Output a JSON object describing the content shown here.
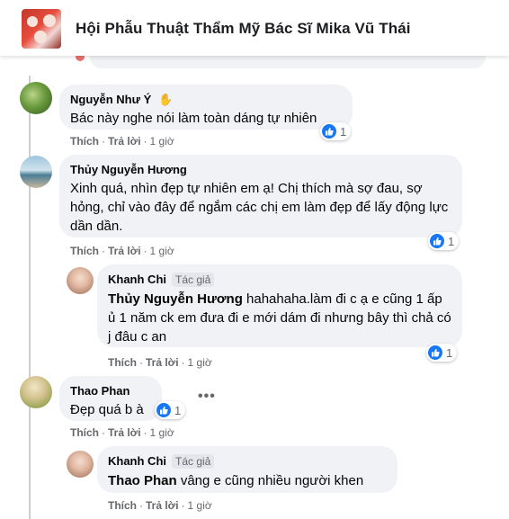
{
  "group": {
    "title": "Hội Phẫu Thuật Thẩm Mỹ Bác Sĩ Mika Vũ Thái"
  },
  "comments": [
    {
      "author": "Nguyễn Như Ý",
      "author_icon": "wave-hand-icon",
      "text": "Bác này nghe nói làm toàn dáng tự nhiên",
      "actions": {
        "like": "Thích",
        "reply": "Trả lời",
        "time": "1 giờ"
      },
      "reactions": "1"
    },
    {
      "author": "Thủy Nguyễn Hương",
      "text": "Xinh quá, nhìn đẹp tự nhiên em ạ! Chị thích mà sợ đau, sợ hỏng, chỉ vào đây để ngắm các chị em làm đẹp để lấy động lực dần dần.",
      "actions": {
        "like": "Thích",
        "reply": "Trả lời",
        "time": "1 giờ"
      },
      "reactions": "1"
    },
    {
      "author": "Khanh Chi",
      "badge": "Tác giả",
      "mention": "Thủy Nguyễn Hương",
      "text": " hahahaha.làm đi c ạ e cũng 1 ấp ủ 1 năm ck em đưa đi e mới dám đi nhưng bây thì chả có j đâu c an",
      "actions": {
        "like": "Thích",
        "reply": "Trả lời",
        "time": "1 giờ"
      },
      "reactions": "1"
    },
    {
      "author": "Thao Phan",
      "text": "Đẹp quá b à",
      "actions": {
        "like": "Thích",
        "reply": "Trả lời",
        "time": "1 giờ"
      },
      "reactions": "1",
      "more": "•••"
    },
    {
      "author": "Khanh Chi",
      "badge": "Tác giả",
      "mention": "Thao Phan",
      "text": " vâng e cũng nhiều người khen",
      "actions": {
        "like": "Thích",
        "reply": "Trả lời",
        "time": "1 giờ"
      }
    }
  ],
  "separator": "·",
  "colors": {
    "like_blue": "#1877f2",
    "bubble": "#f0f2f5",
    "meta": "#65676b"
  }
}
